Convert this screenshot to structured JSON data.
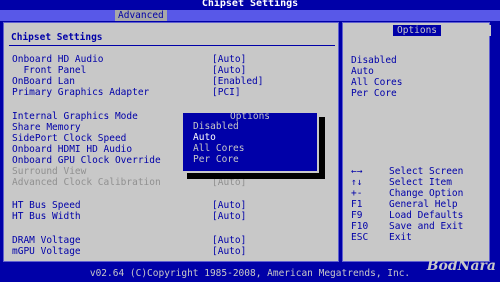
{
  "title": "Chipset Settings",
  "tab": "Advanced",
  "main": {
    "heading": "Chipset Settings",
    "rows": [
      {
        "label": "Onboard HD Audio",
        "value": "[Auto]"
      },
      {
        "label": "  Front Panel",
        "value": "[Auto]"
      },
      {
        "label": "OnBoard Lan",
        "value": "[Enabled]"
      },
      {
        "label": "Primary Graphics Adapter",
        "value": "[PCI]"
      },
      {
        "label": "Internal Graphics Mode",
        "value": ""
      },
      {
        "label": "Share Memory",
        "value": ""
      },
      {
        "label": "SidePort Clock Speed",
        "value": ""
      },
      {
        "label": "Onboard HDMI HD Audio",
        "value": ""
      },
      {
        "label": "Onboard GPU Clock Override",
        "value": ""
      },
      {
        "label": "Surround View",
        "value": ""
      },
      {
        "label": "Advanced Clock Calibration",
        "value": "[Auto]"
      },
      {
        "label": "HT Bus Speed",
        "value": "[Auto]"
      },
      {
        "label": "HT Bus Width",
        "value": "[Auto]"
      },
      {
        "label": "DRAM Voltage",
        "value": "[Auto]"
      },
      {
        "label": "mGPU Voltage",
        "value": "[Auto]"
      }
    ]
  },
  "help": {
    "header": "Options",
    "options": [
      "Disabled",
      "Auto",
      "All Cores",
      "Per Core"
    ],
    "keys": [
      {
        "key": "←→",
        "desc": "Select Screen"
      },
      {
        "key": "↑↓",
        "desc": "Select Item"
      },
      {
        "key": "+-",
        "desc": "Change Option"
      },
      {
        "key": "F1",
        "desc": "General Help"
      },
      {
        "key": "F9",
        "desc": "Load Defaults"
      },
      {
        "key": "F10",
        "desc": "Save and Exit"
      },
      {
        "key": "ESC",
        "desc": "Exit"
      }
    ]
  },
  "popup": {
    "title": "Options",
    "items": [
      "Disabled",
      "Auto",
      "All Cores",
      "Per Core"
    ],
    "selected": "Auto"
  },
  "footer": "v02.64 (C)Copyright 1985-2008, American Megatrends, Inc.",
  "watermark": "BodNara"
}
